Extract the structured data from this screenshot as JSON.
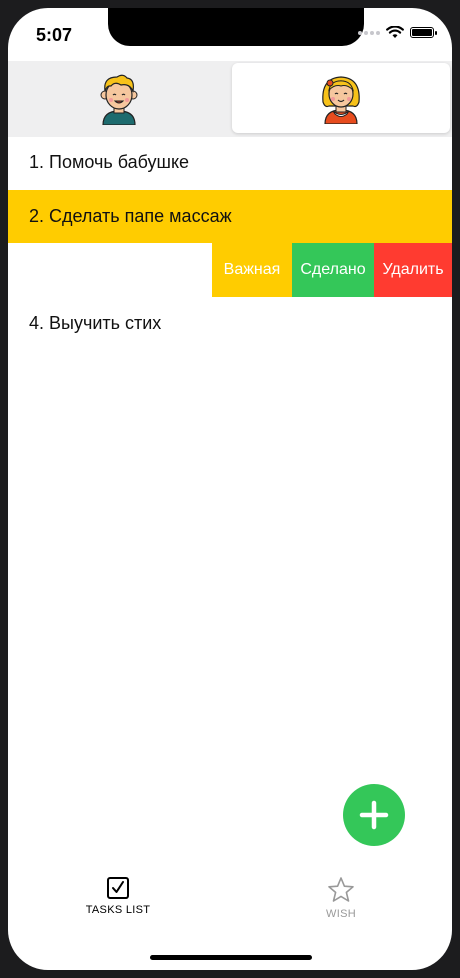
{
  "status_bar": {
    "time": "5:07"
  },
  "segment": {
    "options": [
      {
        "name": "boy-avatar",
        "selected": false
      },
      {
        "name": "girl-avatar",
        "selected": true
      }
    ]
  },
  "tasks": [
    {
      "label": "1. Помочь бабушке",
      "selected": false
    },
    {
      "label": "2. Сделать папе массаж",
      "selected": true
    },
    {
      "label": "",
      "swiped": true
    },
    {
      "label": "4. Выучить стих",
      "selected": false
    }
  ],
  "swipe_actions": {
    "important": "Важная",
    "done": "Сделано",
    "delete": "Удалить"
  },
  "tabbar": {
    "tasks_label": "TASKS LIST",
    "wish_label": "WISH",
    "active": "tasks"
  },
  "colors": {
    "accent_yellow": "#ffcc00",
    "green": "#34c759",
    "red": "#ff3b30",
    "segment_bg": "#efeff0"
  }
}
